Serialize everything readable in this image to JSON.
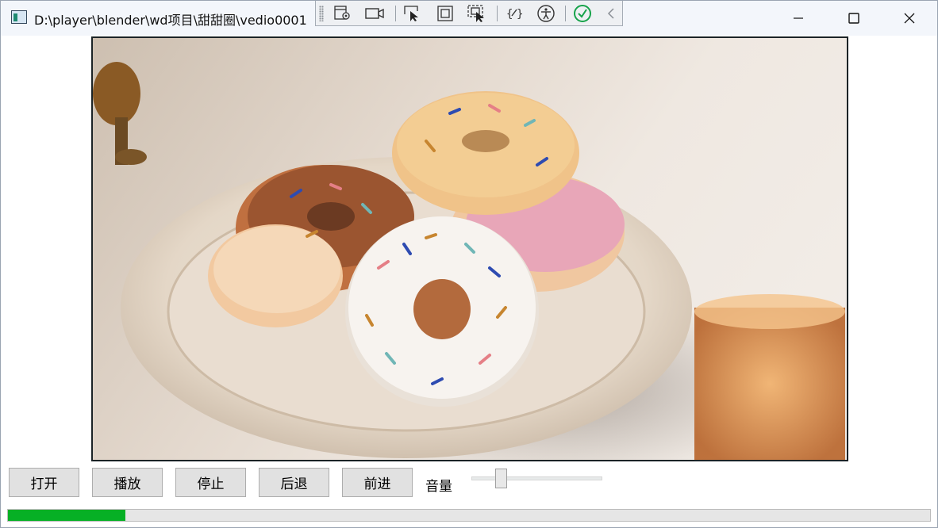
{
  "window": {
    "title": "D:\\player\\blender\\wd项目\\甜甜圈\\vedio0001"
  },
  "titlebar_buttons": [
    "minimize-icon",
    "maximize-icon",
    "close-icon"
  ],
  "debug_toolbar": {
    "icons": [
      "live-visual-tree-icon",
      "video-camera-icon",
      "select-element-icon",
      "display-layout-adorners-icon",
      "track-focused-element-icon",
      "binding-failures-icon",
      "accessibility-icon",
      "check-circle-icon",
      "collapse-chevron-icon"
    ],
    "accent_check": "#16a34a"
  },
  "video": {
    "subject": "donuts-on-plate-frame"
  },
  "controls": {
    "open_label": "打开",
    "play_label": "播放",
    "stop_label": "停止",
    "back_label": "后退",
    "forward_label": "前进",
    "volume_label": "音量",
    "volume_level": 0.2
  },
  "progress": {
    "fraction": 0.127,
    "fill_color": "#06b025"
  }
}
